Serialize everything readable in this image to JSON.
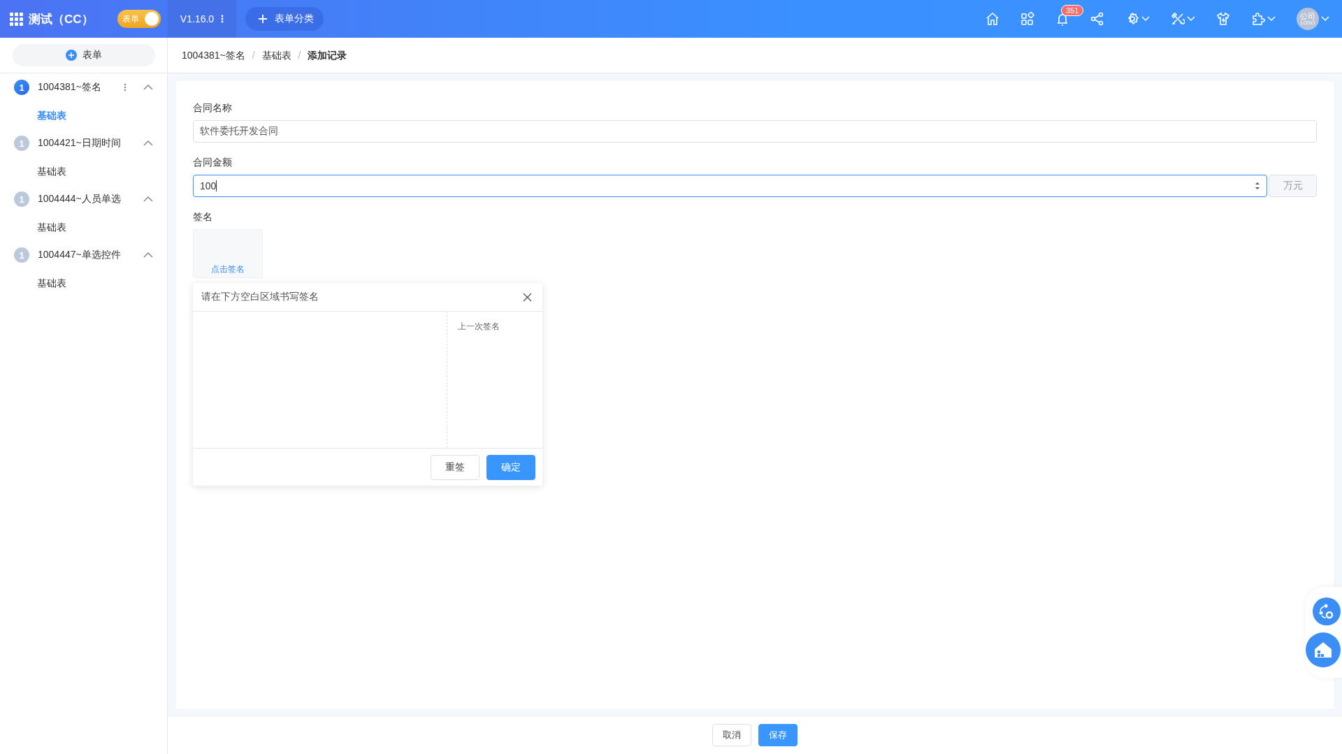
{
  "topbar": {
    "title": "测试（CC）",
    "mode_toggle": {
      "label": "表单",
      "on": true
    },
    "version": "V1.16.0",
    "add_category": "表单分类",
    "icons": [
      {
        "kind": "home"
      },
      {
        "kind": "apps"
      },
      {
        "kind": "bell",
        "badge": "351"
      },
      {
        "kind": "share"
      },
      {
        "kind": "gear",
        "dropdown": true
      },
      {
        "kind": "tools",
        "dropdown": true
      },
      {
        "kind": "shirt"
      },
      {
        "kind": "puzzle",
        "dropdown": true
      }
    ],
    "avatar": {
      "text": "公司",
      "subtext": "LOGO"
    }
  },
  "sidebar": {
    "add_button": "表单",
    "groups": [
      {
        "title": "1004381~签名",
        "badge": "1",
        "active": true,
        "expanded": true,
        "has_menu": true,
        "children": [
          {
            "label": "基础表",
            "selected": true
          }
        ]
      },
      {
        "title": "1004421~日期时间",
        "badge": "1",
        "active": false,
        "expanded": true,
        "has_menu": false,
        "children": [
          {
            "label": "基础表",
            "selected": false
          }
        ]
      },
      {
        "title": "1004444~人员单选",
        "badge": "1",
        "active": false,
        "expanded": true,
        "has_menu": false,
        "children": [
          {
            "label": "基础表",
            "selected": false
          }
        ]
      },
      {
        "title": "1004447~单选控件",
        "badge": "1",
        "active": false,
        "expanded": true,
        "has_menu": false,
        "children": [
          {
            "label": "基础表",
            "selected": false
          }
        ]
      }
    ]
  },
  "breadcrumb": {
    "separator": "/",
    "items": [
      "1004381~签名",
      "基础表",
      "添加记录"
    ]
  },
  "form": {
    "fields": [
      {
        "kind": "text",
        "label": "合同名称",
        "value": "软件委托开发合同",
        "focused": false
      },
      {
        "kind": "number",
        "label": "合同金额",
        "value": "100",
        "unit": "万元",
        "focused": true
      },
      {
        "kind": "signature",
        "label": "签名",
        "action": "点击签名"
      }
    ]
  },
  "signature_popup": {
    "title": "请在下方空白区域书写签名",
    "last_signature_label": "上一次签名",
    "buttons": [
      {
        "label": "重签",
        "kind": "default"
      },
      {
        "label": "确定",
        "kind": "primary"
      }
    ]
  },
  "footer_buttons": [
    {
      "label": "取消",
      "kind": "default"
    },
    {
      "label": "保存",
      "kind": "primary"
    }
  ]
}
